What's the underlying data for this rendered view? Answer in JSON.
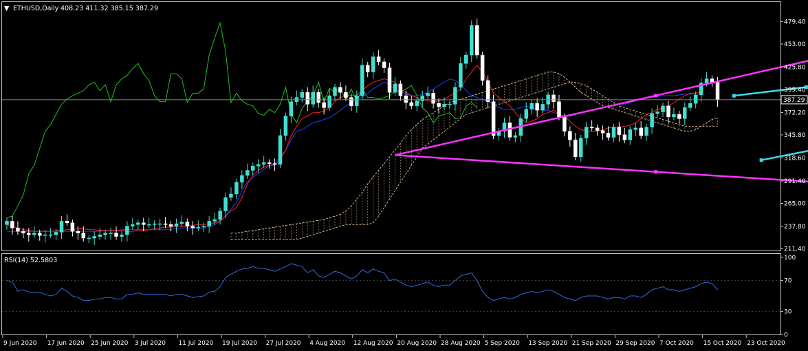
{
  "header": {
    "title": "ETHUSD,Daily",
    "ohlc": "408.23 411.32 385.15 387.29"
  },
  "rsi": {
    "label": "RSI(14) 52.5803",
    "levels": [
      "100",
      "70",
      "30",
      "0"
    ]
  },
  "colors": {
    "background": "#000000",
    "bull_candle": "#40e0d0",
    "bear_candle": "#ffffff",
    "tenkan": "#ff2020",
    "kijun": "#2040ff",
    "chikou": "#20c020",
    "cloud": "#d2b48c",
    "magenta_lines": "#ff33ff",
    "cyan_channel": "#40d8e8",
    "rsi_line": "#2f6fdd"
  },
  "chart_data": [
    {
      "type": "candlestick",
      "title": "ETHUSD,Daily",
      "yticks": [
        "479.40",
        "453.00",
        "425.80",
        "399.40",
        "372.20",
        "345.80",
        "318.60",
        "291.40",
        "265.00",
        "237.80",
        "211.40"
      ],
      "ylim": [
        211.4,
        479.4
      ],
      "current_price": "387.29",
      "xticks": [
        "9 Jun 2020",
        "17 Jun 2020",
        "25 Jun 2020",
        "3 Jul 2020",
        "11 Jul 2020",
        "19 Jul 2020",
        "27 Jul 2020",
        "4 Aug 2020",
        "12 Aug 2020",
        "20 Aug 2020",
        "28 Aug 2020",
        "5 Sep 2020",
        "13 Sep 2020",
        "21 Sep 2020",
        "29 Sep 2020",
        "7 Oct 2020",
        "15 Oct 2020",
        "23 Oct 2020"
      ],
      "close": [
        244,
        236,
        232,
        230,
        228,
        230,
        227,
        228,
        228,
        231,
        244,
        242,
        232,
        230,
        224,
        224,
        226,
        228,
        230,
        230,
        226,
        228,
        238,
        240,
        242,
        240,
        240,
        241,
        241,
        240,
        238,
        241,
        243,
        238,
        236,
        237,
        238,
        244,
        246,
        256,
        272,
        276,
        290,
        298,
        304,
        309,
        311,
        313,
        312,
        311,
        345,
        368,
        385,
        390,
        396,
        382,
        396,
        384,
        378,
        392,
        402,
        396,
        390,
        380,
        392,
        428,
        420,
        438,
        432,
        425,
        396,
        406,
        392,
        384,
        380,
        386,
        392,
        395,
        383,
        379,
        382,
        382,
        402,
        430,
        440,
        475,
        440,
        410,
        385,
        345,
        350,
        360,
        343,
        345,
        365,
        376,
        383,
        375,
        382,
        393,
        385,
        367,
        350,
        340,
        320,
        342,
        355,
        354,
        351,
        348,
        343,
        355,
        346,
        340,
        352,
        354,
        345,
        355,
        371,
        373,
        380,
        367,
        370,
        365,
        378,
        383,
        393,
        407,
        412,
        408,
        387
      ],
      "open": [
        240,
        244,
        236,
        232,
        230,
        228,
        230,
        227,
        228,
        228,
        231,
        244,
        242,
        232,
        230,
        224,
        224,
        226,
        228,
        230,
        230,
        226,
        228,
        238,
        240,
        242,
        240,
        240,
        241,
        241,
        240,
        238,
        241,
        243,
        238,
        236,
        237,
        238,
        244,
        246,
        256,
        272,
        276,
        290,
        298,
        304,
        309,
        311,
        313,
        312,
        311,
        345,
        368,
        385,
        390,
        396,
        382,
        396,
        384,
        378,
        392,
        402,
        396,
        390,
        380,
        392,
        428,
        420,
        438,
        432,
        425,
        396,
        406,
        392,
        384,
        380,
        386,
        392,
        395,
        383,
        379,
        382,
        382,
        402,
        430,
        440,
        475,
        440,
        410,
        385,
        345,
        350,
        360,
        343,
        345,
        365,
        376,
        383,
        375,
        382,
        393,
        385,
        367,
        350,
        340,
        320,
        342,
        355,
        354,
        351,
        348,
        343,
        355,
        346,
        340,
        352,
        354,
        345,
        355,
        371,
        373,
        380,
        367,
        370,
        365,
        378,
        383,
        393,
        407,
        412,
        408
      ],
      "chikou": [
        248,
        250,
        262,
        275,
        300,
        310,
        330,
        350,
        358,
        370,
        382,
        388,
        392,
        395,
        398,
        405,
        408,
        398,
        405,
        385,
        405,
        412,
        416,
        424,
        430,
        418,
        410,
        392,
        385,
        385,
        418,
        418,
        412,
        384,
        395,
        395,
        400,
        440,
        460,
        478,
        445,
        384,
        395,
        386,
        382,
        380,
        371,
        369,
        376,
        372,
        382,
        402,
        370,
        360,
        377,
        386,
        392,
        408,
        385,
        401,
        396,
        401,
        387,
        400,
        385,
        400,
        390,
        390,
        388,
        390,
        392,
        397,
        396,
        400,
        404,
        392,
        378,
        372,
        360,
        368,
        370,
        372,
        365,
        366,
        380,
        384,
        378
      ],
      "tenkan": [
        240,
        238,
        236,
        234,
        233,
        232,
        232,
        232,
        232,
        233,
        233,
        234,
        234,
        235,
        235,
        234,
        234,
        233,
        233,
        233,
        233,
        233,
        232,
        232,
        233,
        233,
        234,
        235,
        236,
        237,
        237,
        238,
        238,
        238,
        239,
        240,
        240,
        241,
        242,
        244,
        250,
        256,
        260,
        272,
        288,
        298,
        304,
        308,
        310,
        310,
        316,
        328,
        345,
        356,
        365,
        368,
        372,
        372,
        374,
        378,
        385,
        390,
        392,
        392,
        393,
        398,
        404,
        408,
        410,
        412,
        410,
        408,
        400,
        396,
        392,
        390,
        388,
        386,
        385,
        386,
        388,
        392,
        395,
        400,
        412,
        420,
        428,
        420,
        408,
        395,
        390,
        385,
        380,
        372,
        365,
        360,
        362,
        365,
        370,
        372,
        375,
        370,
        368,
        362,
        356,
        352,
        350,
        350,
        350,
        352,
        354,
        355,
        355,
        356,
        357,
        360,
        365,
        370,
        372,
        376,
        378,
        380,
        384,
        388,
        392,
        395,
        395,
        396
      ],
      "kijun": [
        232,
        232,
        232,
        232,
        232,
        232,
        232,
        232,
        232,
        232,
        232,
        232,
        232,
        232,
        232,
        232,
        232,
        232,
        233,
        233,
        233,
        234,
        234,
        234,
        234,
        234,
        234,
        234,
        234,
        234,
        234,
        236,
        236,
        236,
        236,
        236,
        236,
        238,
        240,
        244,
        250,
        258,
        266,
        280,
        290,
        296,
        300,
        305,
        310,
        312,
        320,
        328,
        340,
        350,
        352,
        356,
        360,
        362,
        364,
        366,
        370,
        375,
        380,
        384,
        388,
        390,
        395,
        400,
        404,
        408,
        405,
        400,
        397,
        394,
        392,
        392,
        394,
        396,
        400,
        404,
        408,
        412,
        410,
        405,
        398,
        392,
        390,
        388,
        385,
        382,
        378,
        376,
        376,
        376,
        378,
        380,
        378,
        376,
        375,
        375,
        372,
        370,
        368,
        368,
        370,
        372,
        374,
        375,
        376,
        378,
        380,
        380,
        382,
        382,
        384,
        386,
        388,
        389,
        390,
        391,
        392,
        392,
        392,
        393,
        394,
        394,
        395
      ],
      "senkou_a": [
        230,
        230,
        231,
        232,
        233,
        234,
        235,
        236,
        237,
        238,
        239,
        240,
        241,
        242,
        243,
        244,
        245,
        246,
        248,
        250,
        252,
        256,
        262,
        270,
        278,
        288,
        296,
        304,
        312,
        320,
        328,
        336,
        345,
        352,
        358,
        364,
        368,
        372,
        376,
        380,
        384,
        386,
        388,
        390,
        392,
        394,
        396,
        398,
        400,
        402,
        404,
        406,
        408,
        410,
        412,
        414,
        416,
        418,
        420,
        420,
        418,
        414,
        408,
        402,
        396,
        392,
        388,
        384,
        380,
        378,
        376,
        374,
        372,
        370,
        368,
        366,
        364,
        362,
        360,
        358,
        356,
        354,
        352,
        350,
        350,
        352,
        356,
        360,
        364,
        366
      ],
      "senkou_b": [
        222,
        222,
        222,
        222,
        222,
        222,
        222,
        222,
        222,
        222,
        222,
        222,
        222,
        224,
        226,
        228,
        230,
        232,
        234,
        236,
        238,
        240,
        240,
        240,
        240,
        240,
        242,
        250,
        260,
        270,
        280,
        290,
        300,
        310,
        320,
        330,
        335,
        340,
        345,
        350,
        355,
        360,
        365,
        370,
        372,
        374,
        376,
        378,
        380,
        382,
        384,
        386,
        388,
        390,
        392,
        394,
        396,
        398,
        400,
        402,
        404,
        406,
        408,
        408,
        406,
        404,
        400,
        396,
        392,
        388,
        384,
        380,
        378,
        376,
        374,
        372,
        370,
        368,
        366,
        364,
        362,
        360,
        358,
        356,
        356,
        356,
        356,
        356,
        356,
        356
      ],
      "magenta_lines": [
        {
          "x0": 71,
          "y0": 322,
          "x1": 177,
          "y1": 478
        },
        {
          "x0": 71,
          "y0": 322,
          "x1": 177,
          "y1": 278
        }
      ],
      "cyan_channel": [
        {
          "x0": 133,
          "y0": 392,
          "x1": 177,
          "y1": 426
        },
        {
          "x0": 138,
          "y0": 316,
          "x1": 177,
          "y1": 366
        }
      ]
    },
    {
      "type": "line",
      "title": "RSI(14) 52.5803",
      "ylim": [
        0,
        100
      ],
      "yticks": [
        "100",
        "70",
        "30",
        "0"
      ],
      "values": [
        70,
        68,
        56,
        58,
        55,
        54,
        55,
        52,
        50,
        52,
        60,
        56,
        50,
        48,
        44,
        44,
        46,
        46,
        48,
        48,
        46,
        46,
        52,
        52,
        54,
        52,
        52,
        52,
        52,
        52,
        50,
        52,
        52,
        50,
        48,
        49,
        50,
        55,
        56,
        62,
        74,
        78,
        82,
        85,
        86,
        88,
        86,
        86,
        84,
        82,
        85,
        88,
        92,
        90,
        88,
        80,
        84,
        76,
        74,
        78,
        82,
        80,
        76,
        72,
        76,
        84,
        80,
        85,
        82,
        80,
        70,
        72,
        68,
        64,
        62,
        64,
        66,
        68,
        64,
        62,
        64,
        64,
        70,
        76,
        78,
        80,
        70,
        56,
        48,
        44,
        46,
        48,
        46,
        48,
        52,
        54,
        56,
        54,
        56,
        58,
        56,
        52,
        48,
        46,
        44,
        48,
        50,
        50,
        50,
        48,
        46,
        48,
        48,
        46,
        50,
        50,
        48,
        52,
        58,
        60,
        62,
        58,
        58,
        56,
        58,
        60,
        62,
        66,
        68,
        66,
        58
      ]
    }
  ]
}
